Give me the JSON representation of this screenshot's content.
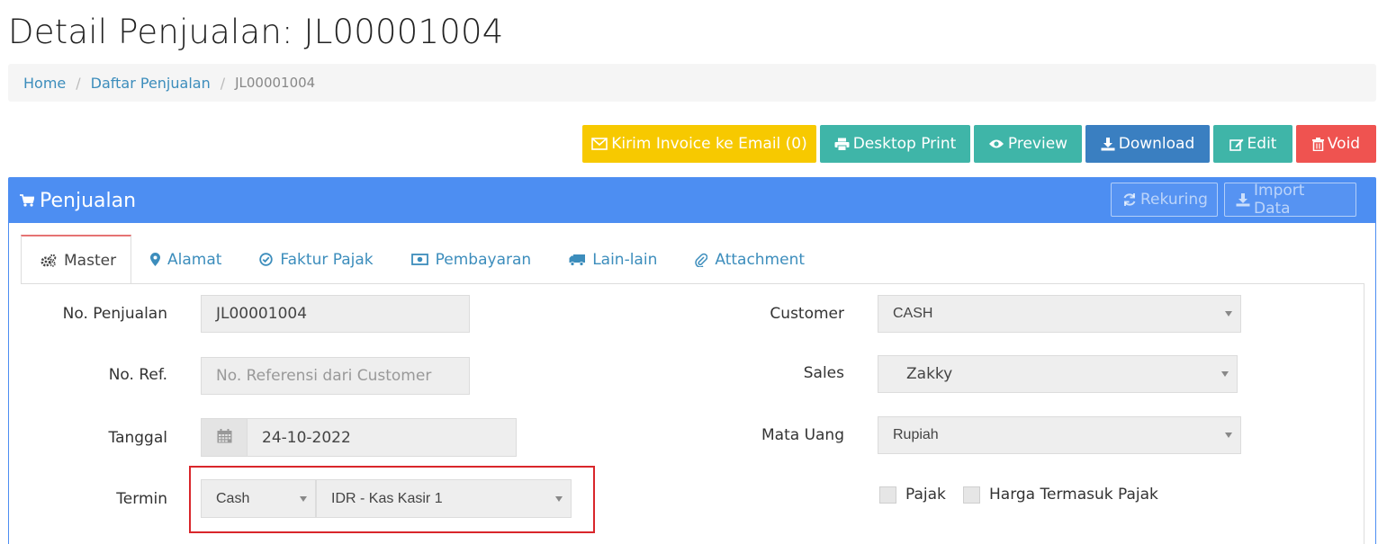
{
  "page": {
    "title": "Detail Penjualan: JL00001004"
  },
  "breadcrumb": {
    "home": "Home",
    "list": "Daftar Penjualan",
    "current": "JL00001004"
  },
  "toolbar": {
    "email": "Kirim Invoice ke Email (0)",
    "desktop_print": "Desktop Print",
    "preview": "Preview",
    "download": "Download",
    "edit": "Edit",
    "void": "Void"
  },
  "panel": {
    "title": "Penjualan",
    "rekuring": "Rekuring",
    "import": "Import Data"
  },
  "tabs": [
    "Master",
    "Alamat",
    "Faktur Pajak",
    "Pembayaran",
    "Lain-lain",
    "Attachment"
  ],
  "form": {
    "no_penjualan": {
      "label": "No. Penjualan",
      "value": "JL00001004"
    },
    "no_ref": {
      "label": "No. Ref.",
      "placeholder": "No. Referensi dari Customer"
    },
    "tanggal": {
      "label": "Tanggal",
      "value": "24-10-2022"
    },
    "termin": {
      "label": "Termin",
      "value": "Cash",
      "kas": "IDR - Kas Kasir 1"
    },
    "customer": {
      "label": "Customer",
      "value": "CASH"
    },
    "sales": {
      "label": "Sales",
      "value": "Zakky"
    },
    "mata_uang": {
      "label": "Mata Uang",
      "value": "Rupiah"
    },
    "pajak": "Pajak",
    "harga_termasuk_pajak": "Harga Termasuk Pajak"
  },
  "colors": {
    "primary": "#4d8ef2",
    "yellow": "#f7c900",
    "teal": "#3fb5a8",
    "blue": "#3a7fc1",
    "red": "#ef5350",
    "highlight": "#d9262b"
  }
}
